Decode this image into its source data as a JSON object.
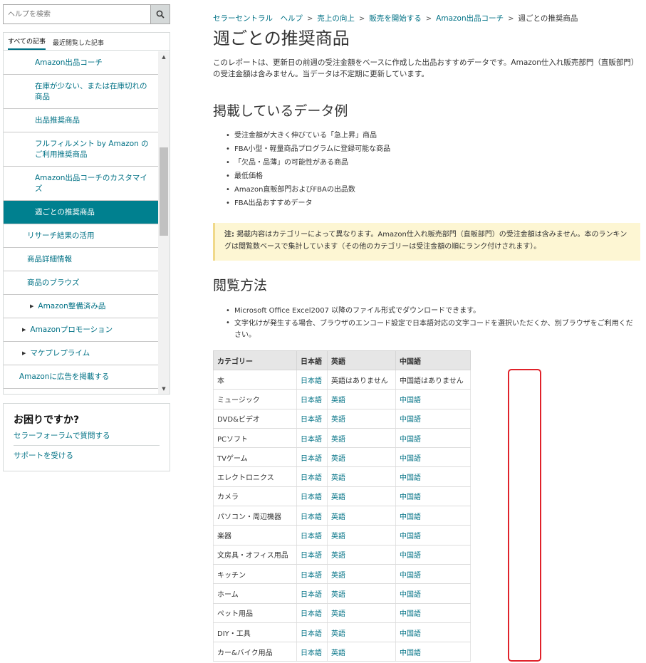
{
  "colors": {
    "accent": "#007185",
    "active_nav_bg": "#00808f",
    "note_bg": "#fdf6d3",
    "highlight": "#e0222a"
  },
  "search": {
    "placeholder": "ヘルプを検索",
    "icon": "search-icon"
  },
  "sidebar": {
    "tabs": [
      "すべての記事",
      "最近閲覧した記事"
    ],
    "partial_top_item": "...",
    "items": [
      {
        "label": "Amazon出品コーチ",
        "level": 3
      },
      {
        "label": "在庫が少ない、または在庫切れの商品",
        "level": 3
      },
      {
        "label": "出品推奨商品",
        "level": 3
      },
      {
        "label": "フルフィルメント by Amazon のご利用推奨商品",
        "level": 3
      },
      {
        "label": "Amazon出品コーチのカスタマイズ",
        "level": 3
      },
      {
        "label": "週ごとの推奨商品",
        "level": 3,
        "active": true
      },
      {
        "label": "リサーチ結果の活用",
        "level": 2
      },
      {
        "label": "商品詳細情報",
        "level": 2
      },
      {
        "label": "商品のブラウズ",
        "level": 2
      },
      {
        "label": "Amazon整備済み品",
        "level": 2,
        "arrow": true
      },
      {
        "label": "Amazonプロモーション",
        "level": 1,
        "arrow": true
      },
      {
        "label": "マケプレプライム",
        "level": 1,
        "arrow": true
      },
      {
        "label": "Amazonに広告を掲載する",
        "level": 0
      }
    ]
  },
  "help_box": {
    "title": "お困りですか?",
    "links": [
      "セラーフォーラムで質問する",
      "サポートを受ける"
    ]
  },
  "breadcrumb": {
    "items": [
      "セラーセントラル　ヘルプ",
      "売上の向上",
      "販売を開始する",
      "Amazon出品コーチ"
    ],
    "current": "週ごとの推奨商品"
  },
  "page": {
    "title": "週ごとの推奨商品",
    "intro": "このレポートは、更新日の前週の受注金額をベースに作成した出品おすすめデータです。Amazon仕入れ販売部門（直販部門）の受注金額は含みません。当データは不定期に更新しています。",
    "section1_title": "掲載しているデータ例",
    "section1_items": [
      "受注金額が大きく伸びている「急上昇」商品",
      "FBA小型・軽量商品プログラムに登録可能な商品",
      "「欠品・品薄」の可能性がある商品",
      "最低価格",
      "Amazon直販部門およびFBAの出品数",
      "FBA出品おすすめデータ"
    ],
    "note_label": "注:",
    "note_text": " 掲載内容はカテゴリーによって異なります。Amazon仕入れ販売部門（直販部門）の受注金額は含みません。本のランキングは閲覧数ベースで集計しています（その他のカテゴリーは受注金額の順にランク付けされます）。",
    "section2_title": "閲覧方法",
    "section2_items": [
      "Microsoft Office Excel2007 以降のファイル形式でダウンロードできます。",
      "文字化けが発生する場合、ブラウザのエンコード設定で日本語対応の文字コードを選択いただくか、別ブラウザをご利用ください。"
    ]
  },
  "table": {
    "headers": [
      "カテゴリー",
      "日本語",
      "英語",
      "中国語"
    ],
    "rows": [
      {
        "category": "本",
        "ja": "日本語",
        "en": "英語はありません",
        "zh": "中国語はありません",
        "en_link": false,
        "zh_link": false
      },
      {
        "category": "ミュージック",
        "ja": "日本語",
        "en": "英語",
        "zh": "中国語",
        "en_link": true,
        "zh_link": true
      },
      {
        "category": "DVD&ビデオ",
        "ja": "日本語",
        "en": "英語",
        "zh": "中国語",
        "en_link": true,
        "zh_link": true
      },
      {
        "category": "PCソフト",
        "ja": "日本語",
        "en": "英語",
        "zh": "中国語",
        "en_link": true,
        "zh_link": true
      },
      {
        "category": "TVゲーム",
        "ja": "日本語",
        "en": "英語",
        "zh": "中国語",
        "en_link": true,
        "zh_link": true
      },
      {
        "category": "エレクトロニクス",
        "ja": "日本語",
        "en": "英語",
        "zh": "中国語",
        "en_link": true,
        "zh_link": true
      },
      {
        "category": "カメラ",
        "ja": "日本語",
        "en": "英語",
        "zh": "中国語",
        "en_link": true,
        "zh_link": true
      },
      {
        "category": "パソコン・周辺機器",
        "ja": "日本語",
        "en": "英語",
        "zh": "中国語",
        "en_link": true,
        "zh_link": true
      },
      {
        "category": "楽器",
        "ja": "日本語",
        "en": "英語",
        "zh": "中国語",
        "en_link": true,
        "zh_link": true
      },
      {
        "category": "文房具・オフィス用品",
        "ja": "日本語",
        "en": "英語",
        "zh": "中国語",
        "en_link": true,
        "zh_link": true
      },
      {
        "category": "キッチン",
        "ja": "日本語",
        "en": "英語",
        "zh": "中国語",
        "en_link": true,
        "zh_link": true
      },
      {
        "category": "ホーム",
        "ja": "日本語",
        "en": "英語",
        "zh": "中国語",
        "en_link": true,
        "zh_link": true
      },
      {
        "category": "ペット用品",
        "ja": "日本語",
        "en": "英語",
        "zh": "中国語",
        "en_link": true,
        "zh_link": true
      },
      {
        "category": "DIY・工具",
        "ja": "日本語",
        "en": "英語",
        "zh": "中国語",
        "en_link": true,
        "zh_link": true
      },
      {
        "category": "カー&バイク用品",
        "ja": "日本語",
        "en": "英語",
        "zh": "中国語",
        "en_link": true,
        "zh_link": true
      }
    ]
  }
}
